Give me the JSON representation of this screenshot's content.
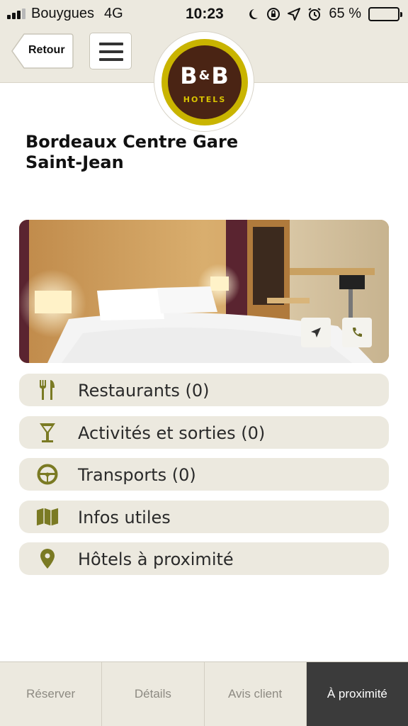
{
  "status": {
    "carrier": "Bouygues",
    "network": "4G",
    "time": "10:23",
    "battery": "65 %",
    "battery_level": 0.65
  },
  "header": {
    "back_label": "Retour",
    "menu_icon": "hamburger-icon",
    "logo_text": "B&B",
    "logo_subtext": "HOTELS"
  },
  "hotel": {
    "name_line1": "Bordeaux Centre Gare",
    "name_line2": "Saint-Jean"
  },
  "photo": {
    "nav_icon": "navigation-arrow-icon",
    "call_icon": "phone-icon"
  },
  "menu": [
    {
      "label": "Restaurants (0)",
      "icon": "fork-knife-icon"
    },
    {
      "label": "Activités et sorties (0)",
      "icon": "cocktail-glass-icon"
    },
    {
      "label": "Transports (0)",
      "icon": "steering-wheel-icon"
    },
    {
      "label": "Infos utiles",
      "icon": "map-icon"
    },
    {
      "label": "Hôtels à proximité",
      "icon": "map-pin-icon"
    }
  ],
  "tabs": [
    {
      "label": "Réserver"
    },
    {
      "label": "Détails"
    },
    {
      "label": "Avis client"
    },
    {
      "label": "À proximité",
      "active": true
    }
  ],
  "colors": {
    "accent": "#8a8a2a",
    "header_bg": "#ece9df",
    "active_tab": "#3b3b3b",
    "logo_brown": "#4a2414",
    "logo_gold": "#c9b400"
  }
}
